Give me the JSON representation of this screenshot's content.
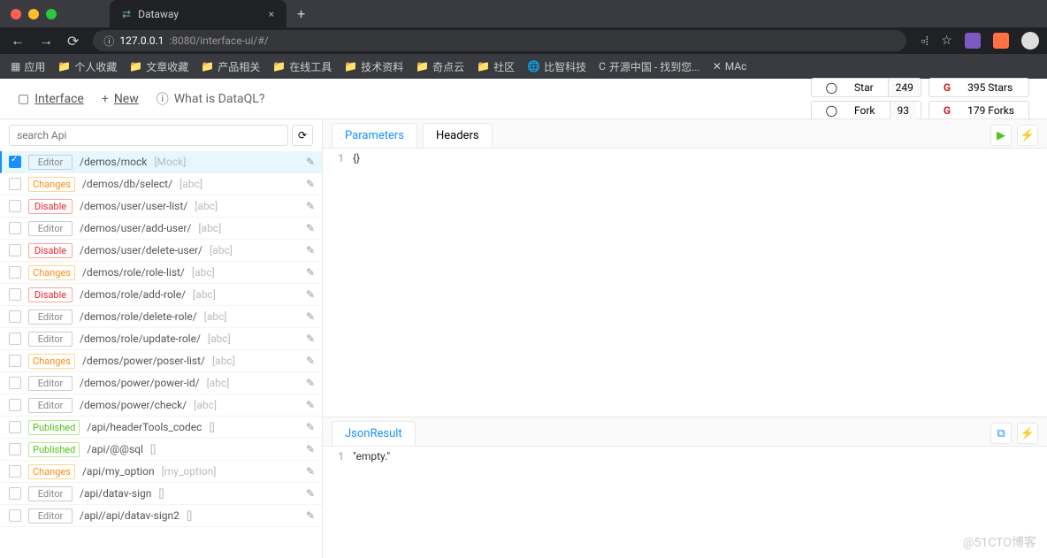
{
  "browser": {
    "tab_title": "Dataway",
    "url_prefix": "127.0.0.1",
    "url_suffix": ":8080/interface-ui/#/"
  },
  "bookmarks": [
    "应用",
    "个人收藏",
    "文章收藏",
    "产品相关",
    "在线工具",
    "技术资料",
    "奇点云",
    "社区",
    "比智科技",
    "开源中国 - 找到您...",
    "MAc"
  ],
  "toolbar": {
    "interface": "Interface",
    "new": "New",
    "whatis": "What is DataQL?",
    "star": "Star",
    "star_count": "249",
    "fork": "Fork",
    "fork_count": "93",
    "gitee_stars": "395 Stars",
    "gitee_forks": "179 Forks"
  },
  "search_placeholder": "search Api",
  "apis": [
    {
      "status": "Editor",
      "path": "/demos/mock",
      "extra": "[Mock]",
      "sel": true
    },
    {
      "status": "Changes",
      "path": "/demos/db/select/",
      "extra": "[abc]"
    },
    {
      "status": "Disable",
      "path": "/demos/user/user-list/",
      "extra": "[abc]"
    },
    {
      "status": "Editor",
      "path": "/demos/user/add-user/",
      "extra": "[abc]"
    },
    {
      "status": "Disable",
      "path": "/demos/user/delete-user/",
      "extra": "[abc]"
    },
    {
      "status": "Changes",
      "path": "/demos/role/role-list/",
      "extra": "[abc]"
    },
    {
      "status": "Disable",
      "path": "/demos/role/add-role/",
      "extra": "[abc]"
    },
    {
      "status": "Editor",
      "path": "/demos/role/delete-role/",
      "extra": "[abc]"
    },
    {
      "status": "Editor",
      "path": "/demos/role/update-role/",
      "extra": "[abc]"
    },
    {
      "status": "Changes",
      "path": "/demos/power/poser-list/",
      "extra": "[abc]"
    },
    {
      "status": "Editor",
      "path": "/demos/power/power-id/",
      "extra": "[abc]"
    },
    {
      "status": "Editor",
      "path": "/demos/power/check/",
      "extra": "[abc]"
    },
    {
      "status": "Published",
      "path": "/api/headerTools_codec",
      "extra": "[]"
    },
    {
      "status": "Published",
      "path": "/api/@@sql",
      "extra": "[]"
    },
    {
      "status": "Changes",
      "path": "/api/my_option",
      "extra": "[my_option]"
    },
    {
      "status": "Editor",
      "path": "/api/datav-sign",
      "extra": "[]"
    },
    {
      "status": "Editor",
      "path": "/api//api/datav-sign2",
      "extra": "[]"
    }
  ],
  "tabs": {
    "top": [
      "Parameters",
      "Headers"
    ],
    "top_active": 0,
    "top_code": "{}",
    "bottom": [
      "JsonResult"
    ],
    "bottom_code": "\"empty.\""
  },
  "watermark": "@51CTO博客"
}
